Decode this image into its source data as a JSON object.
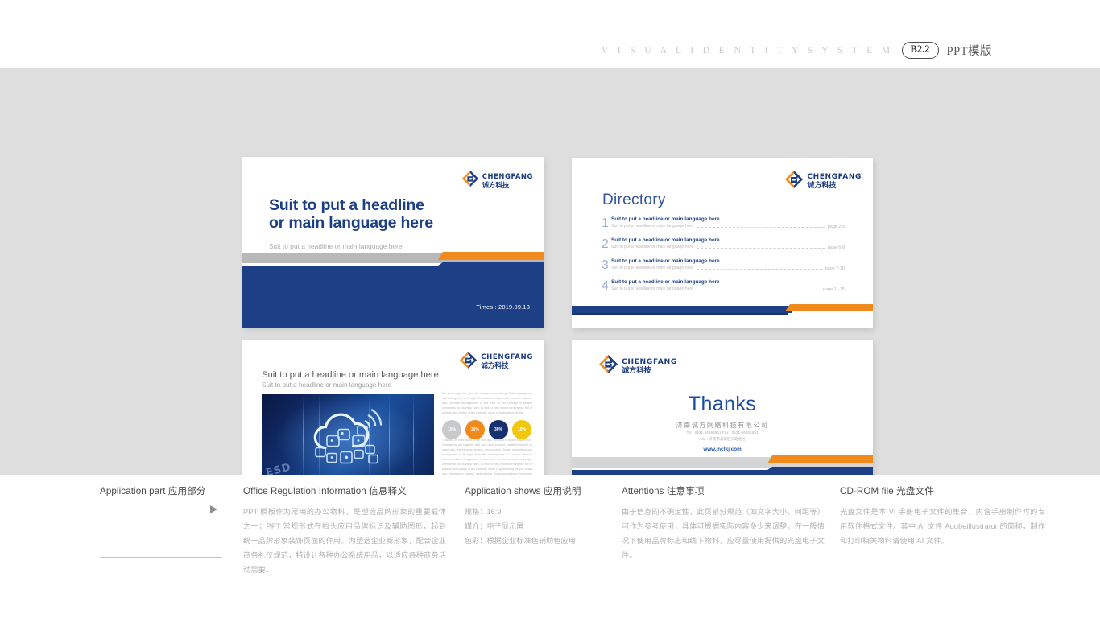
{
  "header": {
    "vis_title": "V I S U A L   I D E N T I T Y   S Y S T E M",
    "code": "B2.2",
    "label": "PPT模版"
  },
  "brand": {
    "logo_en": "CHENGFANG",
    "logo_cn": "诚方科技",
    "blue": "#1c3f85",
    "orange": "#f08a1c",
    "gray_stage": "#dedede"
  },
  "slide1": {
    "title_line1": "Suit to put a headline",
    "title_line2": "or main language here",
    "subtitle": "Suit to put a headline or main language here",
    "times": "Times : 2019.09.18"
  },
  "slide2": {
    "heading": "Directory",
    "items": [
      {
        "num": "1",
        "title": "Suit to put a headline or main language here",
        "sub": "Suit to put a headline or main language here",
        "page": "page 2-5"
      },
      {
        "num": "2",
        "title": "Suit to put a headline or main language here",
        "sub": "Suit to put a headline or main language here",
        "page": "page 6-8"
      },
      {
        "num": "3",
        "title": "Suit to put a headline or main language here",
        "sub": "Suit to put a headline or main language here",
        "page": "page 7-10"
      },
      {
        "num": "4",
        "title": "Suit to put a headline or main language here",
        "sub": "Suit to put a headline or main language here",
        "page": "page 11-15"
      }
    ]
  },
  "slide3": {
    "title": "Suit to put a headline or main language here",
    "subtitle": "Suit to put a headline or main language here",
    "image_caption": "ESD",
    "paragraph1": "Ten years ago, the phoenix nirvana, restructuring. Today, guangdong shu boxing feet, to fly high. Scientific development is our new mission, and scientific management is the core of our concept of people oriented is our starting point, to build a new modern enterprise full of passion and vitality, is the common vision of guangdong people.",
    "paragraph2": "Tidal flat on both sides of the rich, and the wind is blown suspension. Guangdong will together with you, hand in hand, create brilliance! on years ago, the phoenix nirvana, restructuring. Today, guangdong shu boxing feet, to fly high. Scientific development is our new mission, and scientific management is the core of our concept of people oriented is our starting point, to build a new modern enterprise full of passion and vitality, is the common vision of guangdong people. years ago, the phoenix nirvana, restructuring. Today, guangdong shu boxing feet, to fly high. Scientific development is our new mission, and scientific management is the core of",
    "dots": [
      {
        "label": "10%",
        "color": "#c7c9cb"
      },
      {
        "label": "20%",
        "color": "#f08a1c"
      },
      {
        "label": "30%",
        "color": "#16306f"
      },
      {
        "label": "10%",
        "color": "#f2c80f"
      }
    ]
  },
  "slide4": {
    "thanks": "Thanks",
    "company": "济南诚方网络科技有限公司",
    "tel_fax": "Tel : 0531-66953651   Fax : 0531-66953651",
    "address": "Add : 济南市高新区汉峪金谷",
    "website": "www.jncfkj.com"
  },
  "notes": {
    "col1": {
      "heading": "Application part  应用部分",
      "arrow": "play-arrow"
    },
    "col2": {
      "heading": "Office Regulation Information 信息释义",
      "body": "PPT 模板作为常用的办公物料，是塑造品牌形象的重要载体之一；PPT 常规形式在档头应用品牌标识及辅助图形，起到统一品牌形象装饰页面的作用。为塑造企业新形象，配合企业商务礼仪规范，特设计各种办公系统用品，以适应各种商务活动需要。"
    },
    "col3": {
      "heading": "Application shows 应用说明",
      "lines": [
        "规格：16:9",
        "媒介：电子显示屏",
        "色彩：根据企业标准色辅助色应用"
      ]
    },
    "col4": {
      "heading": "Attentions 注意事项",
      "body": "由于信息的不确定性，此页部分规范（如文字大小、间距等）可作为参考使用，具体可根据实际内容多少来调整。在一般情况下使用品牌标志和线下物料，应尽量使用提供的光盘电子文件。"
    },
    "col5": {
      "heading": "CD-ROM file 光盘文件",
      "body": "光盘文件是本 VI 手册电子文件的集合，内含手册制作时的专用软件格式文件。其中 AI 文件 Adobeillustrator 的简称，制作和打印相关物料请使用 AI 文件。"
    }
  }
}
